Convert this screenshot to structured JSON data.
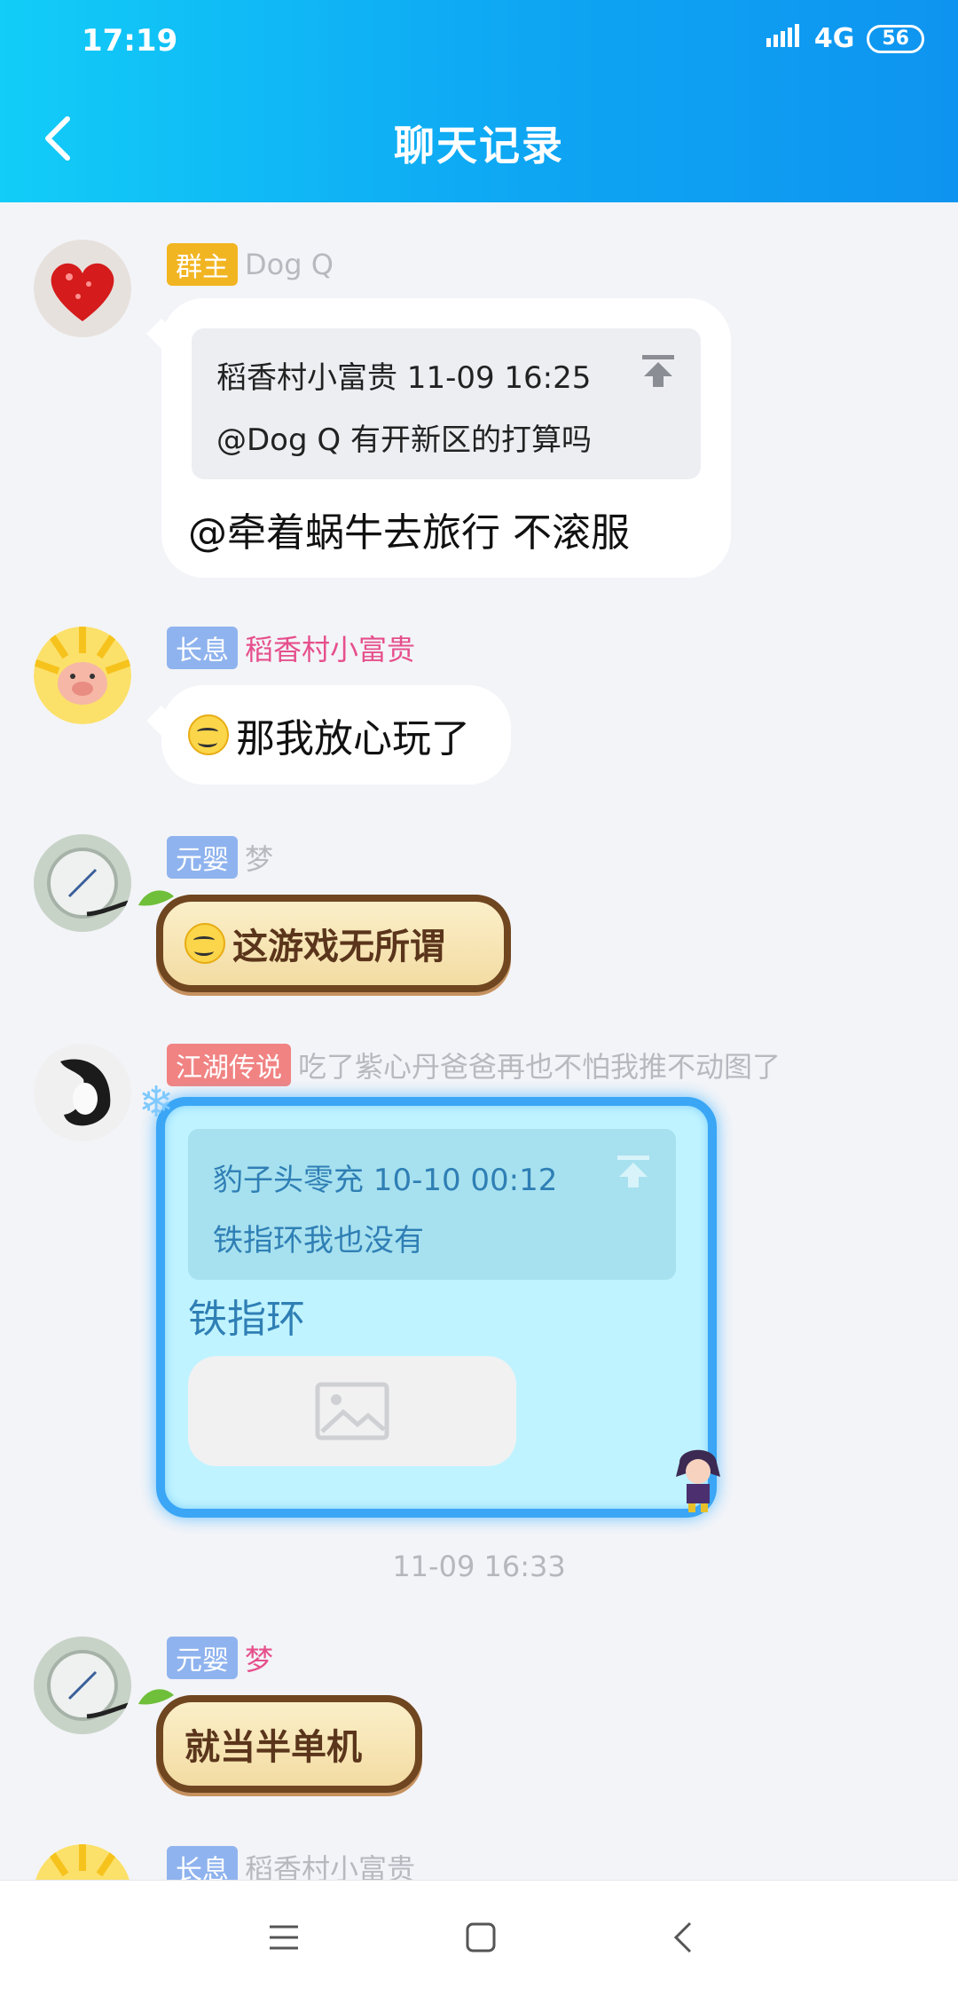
{
  "status_bar": {
    "time": "17:19",
    "network": "4G",
    "battery": "56"
  },
  "header": {
    "title": "聊天记录"
  },
  "messages": [
    {
      "badge": "群主",
      "sender": "Dog Q",
      "quote_head": "稻香村小富贵 11-09 16:25",
      "quote_body": "@Dog Q 有开新区的打算吗",
      "text": "@牵着蜗牛去旅行 不滚服"
    },
    {
      "badge": "长息",
      "sender": "稻香村小富贵",
      "text": "那我放心玩了"
    },
    {
      "badge": "元婴",
      "sender": "梦",
      "text": "这游戏无所谓"
    },
    {
      "badge": "江湖传说",
      "sender": "吃了紫心丹爸爸再也不怕我推不动图了",
      "quote_head": "豹子头零充 10-10 00:12",
      "quote_body": "铁指环我也没有",
      "text": "铁指环"
    },
    {
      "badge": "元婴",
      "sender": "梦",
      "text": "就当半单机"
    },
    {
      "badge": "长息",
      "sender": "稻香村小富贵"
    }
  ],
  "timestamp": "11-09 16:33",
  "icons": {
    "back": "chevron-left-icon",
    "pin": "pin-top-icon",
    "image": "image-placeholder-icon",
    "nav_menu": "menu-icon",
    "nav_home": "home-square-icon",
    "nav_back": "back-triangle-icon"
  },
  "colors": {
    "header_start": "#12cdf8",
    "header_end": "#0e94f0",
    "page_bg": "#f3f4f8"
  }
}
